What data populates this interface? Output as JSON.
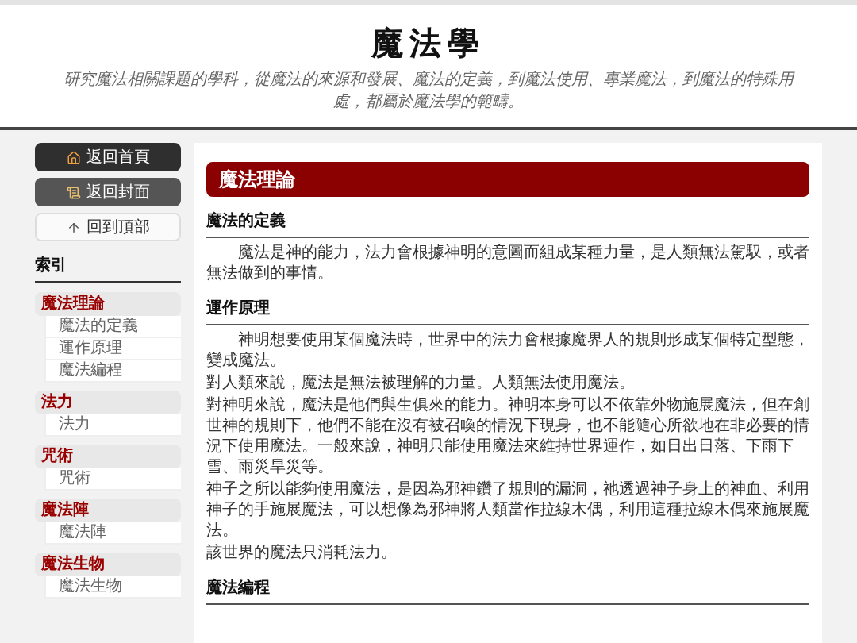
{
  "header": {
    "title": "魔法學",
    "subtitle": "研究魔法相關課題的學科，從魔法的來源和發展、魔法的定義，到魔法使用、專業魔法，到魔法的特殊用處，都屬於魔法學的範疇。"
  },
  "nav_buttons": [
    {
      "label": "返回首頁",
      "kind": "home"
    },
    {
      "label": "返回封面",
      "kind": "cover"
    },
    {
      "label": "回到頂部",
      "kind": "top"
    }
  ],
  "index": {
    "heading": "索引",
    "groups": [
      {
        "label": "魔法理論",
        "children": [
          {
            "label": "魔法的定義"
          },
          {
            "label": "運作原理"
          },
          {
            "label": "魔法編程"
          }
        ]
      },
      {
        "label": "法力",
        "children": [
          {
            "label": "法力"
          }
        ]
      },
      {
        "label": "咒術",
        "children": [
          {
            "label": "咒術"
          }
        ]
      },
      {
        "label": "魔法陣",
        "children": [
          {
            "label": "魔法陣"
          }
        ]
      },
      {
        "label": "魔法生物",
        "children": [
          {
            "label": "魔法生物"
          }
        ]
      }
    ]
  },
  "main": {
    "section_title": "魔法理論",
    "subsections": [
      {
        "heading": "魔法的定義",
        "paragraphs": [
          {
            "text": "魔法是神的能力，法力會根據神明的意圖而組成某種力量，是人類無法駕馭，或者無法做到的事情。",
            "indented": true
          }
        ]
      },
      {
        "heading": "運作原理",
        "paragraphs": [
          {
            "text": "神明想要使用某個魔法時，世界中的法力會根據魔界人的規則形成某個特定型態，變成魔法。",
            "indented": true
          },
          {
            "text": "對人類來說，魔法是無法被理解的力量。人類無法使用魔法。",
            "indented": false
          },
          {
            "text": "對神明來說，魔法是他們與生俱來的能力。神明本身可以不依靠外物施展魔法，但在創世神的規則下，他們不能在沒有被召喚的情況下現身，也不能隨心所欲地在非必要的情況下使用魔法。一般來說，神明只能使用魔法來維持世界運作，如日出日落、下雨下雪、雨災旱災等。",
            "indented": false
          },
          {
            "text": "神子之所以能夠使用魔法，是因為邪神鑽了規則的漏洞，祂透過神子身上的神血、利用神子的手施展魔法，可以想像為邪神將人類當作拉線木偶，利用這種拉線木偶來施展魔法。",
            "indented": false
          },
          {
            "text": "該世界的魔法只消耗法力。",
            "indented": false
          }
        ]
      },
      {
        "heading": "魔法編程"
      }
    ]
  }
}
